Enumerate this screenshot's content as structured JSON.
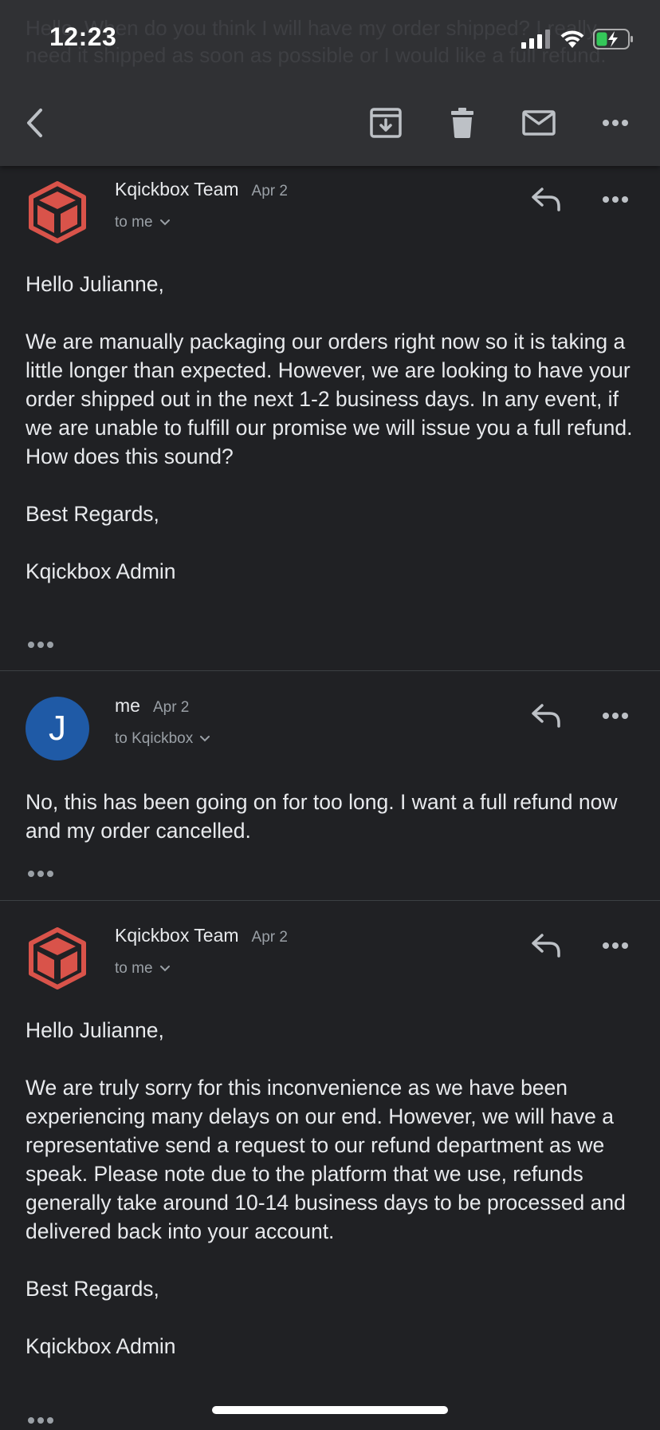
{
  "status_bar": {
    "time": "12:23"
  },
  "background_text": "Hello. When do you think I will have my order shipped? I really need it shipped as soon as possible or I would like a full refund.",
  "toolbar": {
    "back_icon": "chevron-left-icon",
    "archive_icon": "archive-icon",
    "delete_icon": "trash-icon",
    "mark_unread_icon": "mail-icon",
    "more_icon": "more-horizontal-icon"
  },
  "messages": [
    {
      "sender": "Kqickbox Team",
      "date": "Apr 2",
      "recipient": "to me",
      "avatar_icon": "kqickbox-cube-logo",
      "body": [
        "Hello Julianne,",
        "We are manually packaging our orders right now so it is taking a little longer than expected. However, we are looking to have your order shipped out in the next 1-2 business days. In any event, if we are unable to fulfill our promise we will issue you a full refund. How does this sound?",
        "Best Regards,",
        "Kqickbox Admin"
      ]
    },
    {
      "sender": "me",
      "date": "Apr 2",
      "recipient": "to Kqickbox",
      "avatar_letter": "J",
      "body": [
        "No, this has been going on for too long. I want a full refund now and my order cancelled."
      ]
    },
    {
      "sender": "Kqickbox Team",
      "date": "Apr 2",
      "recipient": "to me",
      "avatar_icon": "kqickbox-cube-logo",
      "body": [
        "Hello Julianne,",
        "We are truly sorry for this inconvenience as we have been experiencing many delays on our end. However, we will have a representative send a request to our refund department as we speak. Please note due to the platform that we use, refunds generally take around 10-14 business days to be processed and delivered back into your account.",
        "Best Regards,",
        "Kqickbox Admin"
      ]
    }
  ],
  "colors": {
    "background": "#202124",
    "toolbar": "#303134",
    "text": "#e8eaed",
    "secondary_text": "#9aa0a6",
    "brand_logo": "#d9534a",
    "avatar_me": "#1f5aa6",
    "battery": "#34c759"
  }
}
